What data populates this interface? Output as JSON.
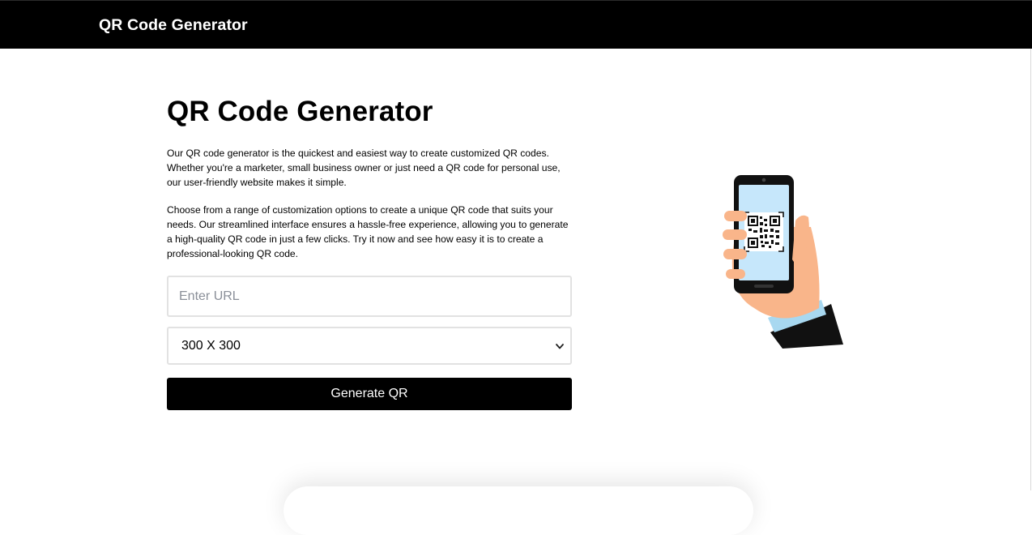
{
  "navbar": {
    "brand": "QR Code Generator"
  },
  "main": {
    "title": "QR Code Generator",
    "paragraphs": [
      "Our QR code generator is the quickest and easiest way to create customized QR codes. Whether you're a marketer, small business owner or just need a QR code for personal use, our user-friendly website makes it simple.",
      "Choose from a range of customization options to create a unique QR code that suits your needs. Our streamlined interface ensures a hassle-free experience, allowing you to generate a high-quality QR code in just a few clicks. Try it now and see how easy it is to create a professional-looking QR code."
    ]
  },
  "form": {
    "url_placeholder": "Enter URL",
    "url_value": "",
    "size_selected": "300 X 300",
    "generate_label": "Generate QR"
  },
  "icons": {
    "select_chevron": "chevron-down-icon",
    "illustration": "hand-holding-phone-qr-icon"
  },
  "colors": {
    "navbar_bg": "#000000",
    "button_bg": "#000000",
    "skin": "#f9b58a",
    "screen": "#c6e7fb",
    "sleeve": "#a8d8f0"
  }
}
